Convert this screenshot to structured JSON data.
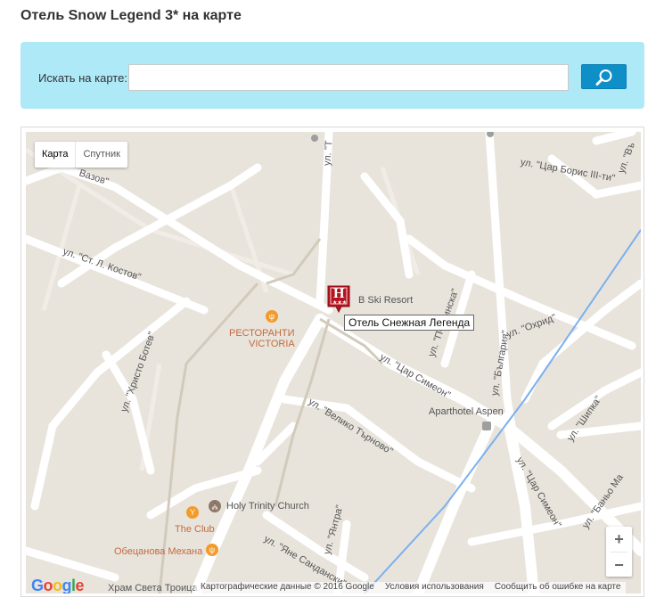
{
  "page": {
    "title": "Отель Snow Legend 3* на карте"
  },
  "search": {
    "label": "Искать на карте:",
    "value": "",
    "placeholder": "",
    "button_icon": "search-icon"
  },
  "map": {
    "type_control": {
      "map": "Карта",
      "satellite": "Спутник",
      "active": "map"
    },
    "streets": [
      "ул. \"Ст. Л. Костов\"",
      "ул. \"Христо Ботев\"",
      "ул. \"Цар Симеон\"",
      "ул. \"Велико Търново\"",
      "ул. \"Яне Сандански\"",
      "ул. \"Янтра\"",
      "ул. \"Охрид\"",
      "ул. \"Шипка\"",
      "ул. \"България\"",
      "ул. \"Цар Борис III-ти\"",
      "ул. \"Пчелинска\"",
      "ул. \"Цар Симеон\"",
      "ул. \"Баньо Ма",
      "ул. \"Въ",
      "ул. \"Т",
      "Вазов\"",
      "Храм Света Троица"
    ],
    "pois": {
      "resort": "Ski Resort",
      "resort_prefix": "B",
      "restaurant_line1": "РЕСТОРАНТИ",
      "restaurant_line2": "VICTORIA",
      "aparthotel": "Aparthotel Aspen",
      "church": "Holy Trinity Church",
      "club": "The Club",
      "mehana": "Обецанова Механа"
    },
    "marker": {
      "letter": "H",
      "stars": "★★★",
      "color": "#b3121f"
    },
    "tooltip": "Отель Снежная Легенда",
    "zoom": {
      "in": "+",
      "out": "−"
    },
    "logo": {
      "letters": [
        "G",
        "o",
        "o",
        "g",
        "l",
        "e"
      ],
      "colors": [
        "#4285f4",
        "#ea4335",
        "#fbbc05",
        "#4285f4",
        "#34a853",
        "#ea4335"
      ]
    },
    "attribution": {
      "data": "Картографические данные © 2016 Google",
      "terms": "Условия использования",
      "report": "Сообщить об ошибке на карте"
    }
  }
}
